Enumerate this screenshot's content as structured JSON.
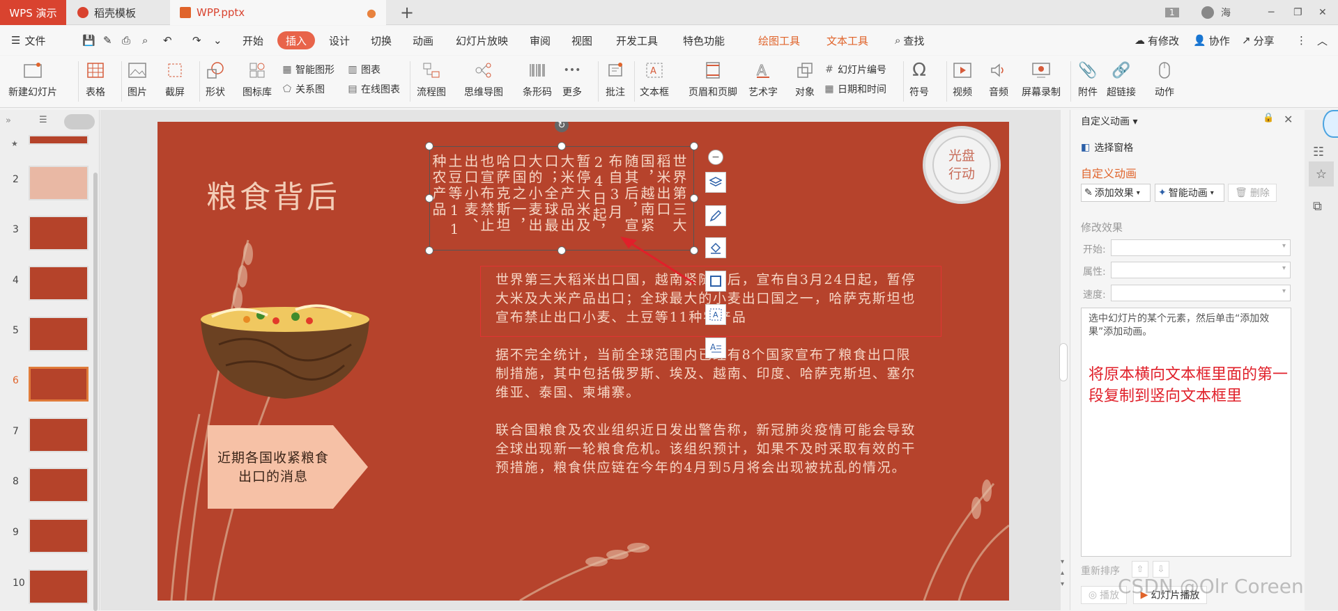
{
  "tabs": {
    "wps": "WPS 演示",
    "docer": "稻壳模板",
    "file": "WPP.pptx",
    "file_dot": "●",
    "add": "+"
  },
  "titlebar_right": {
    "badge": "1",
    "user": "海"
  },
  "menu": {
    "file": "文件",
    "items": [
      "开始",
      "插入",
      "设计",
      "切换",
      "动画",
      "幻灯片放映",
      "审阅",
      "视图",
      "开发工具",
      "特色功能",
      "绘图工具",
      "文本工具",
      "查找"
    ],
    "active": "插入",
    "right": [
      "有修改",
      "协作",
      "分享"
    ]
  },
  "ribbon": {
    "new_slide": "新建幻灯片",
    "table": "表格",
    "image": "图片",
    "screenshot": "截屏",
    "shape": "形状",
    "icon_lib": "图标库",
    "smart_art": "智能图形",
    "chart": "图表",
    "relation": "关系图",
    "online_chart": "在线图表",
    "flow": "流程图",
    "mind": "思维导图",
    "barcode": "条形码",
    "more": "更多",
    "comment": "批注",
    "textbox": "文本框",
    "header_footer": "页眉和页脚",
    "art_text": "艺术字",
    "object": "对象",
    "slide_no": "幻灯片编号",
    "datetime": "日期和时间",
    "symbol": "符号",
    "video": "视频",
    "audio": "音频",
    "screen_rec": "屏幕录制",
    "attach": "附件",
    "hyperlink": "超链接",
    "action": "动作"
  },
  "slide_numbers": [
    "2",
    "3",
    "4",
    "5",
    "6",
    "7",
    "8",
    "9",
    "10"
  ],
  "slide": {
    "title": "粮食背后",
    "badge": "光盘\n行动",
    "vertical_text": "世界第三大稻米出口国，越南紧随其后，宣布自3月24日起，暂停大米及大米产品出口；全球最大的小麦出口国之一，哈萨克斯坦也宣布禁止出口小麦、土豆等11种农产品",
    "para1": "世界第三大稻米出口国，越南紧随其后，宣布自3月24日起，暂停大米及大米产品出口；全球最大的小麦出口国之一，哈萨克斯坦也宣布禁止出口小麦、土豆等11种农产品",
    "para2": "据不完全统计，当前全球范围内已经有8个国家宣布了粮食出口限制措施，其中包括俄罗斯、埃及、越南、印度、哈萨克斯坦、塞尔维亚、泰国、柬埔寨。",
    "para3": "联合国粮食及农业组织近日发出警告称，新冠肺炎疫情可能会导致全球出现新一轮粮食危机。该组织预计，如果不及时采取有效的干预措施，粮食供应链在今年的4月到5月将会出现被扰乱的情况。",
    "arrow_label": "近期各国收紧粮食出口的消息"
  },
  "panel": {
    "title": "自定义动画",
    "select_pane": "选择窗格",
    "section": "自定义动画",
    "add_effect": "添加效果",
    "smart_anim": "智能动画",
    "delete": "删除",
    "modify": "修改效果",
    "start": "开始:",
    "property": "属性:",
    "speed": "速度:",
    "hint": "选中幻灯片的某个元素，然后单击“添加效果”添加动画。",
    "note": "将原本横向文本框里面的第一段复制到竖向文本框里",
    "reorder": "重新排序",
    "play": "播放",
    "slideshow": "幻灯片播放"
  },
  "watermark": "CSDN @Olr Coreen",
  "colors": {
    "accent": "#e8644a",
    "slide_bg": "#b6432c",
    "note_red": "#e0202a"
  }
}
